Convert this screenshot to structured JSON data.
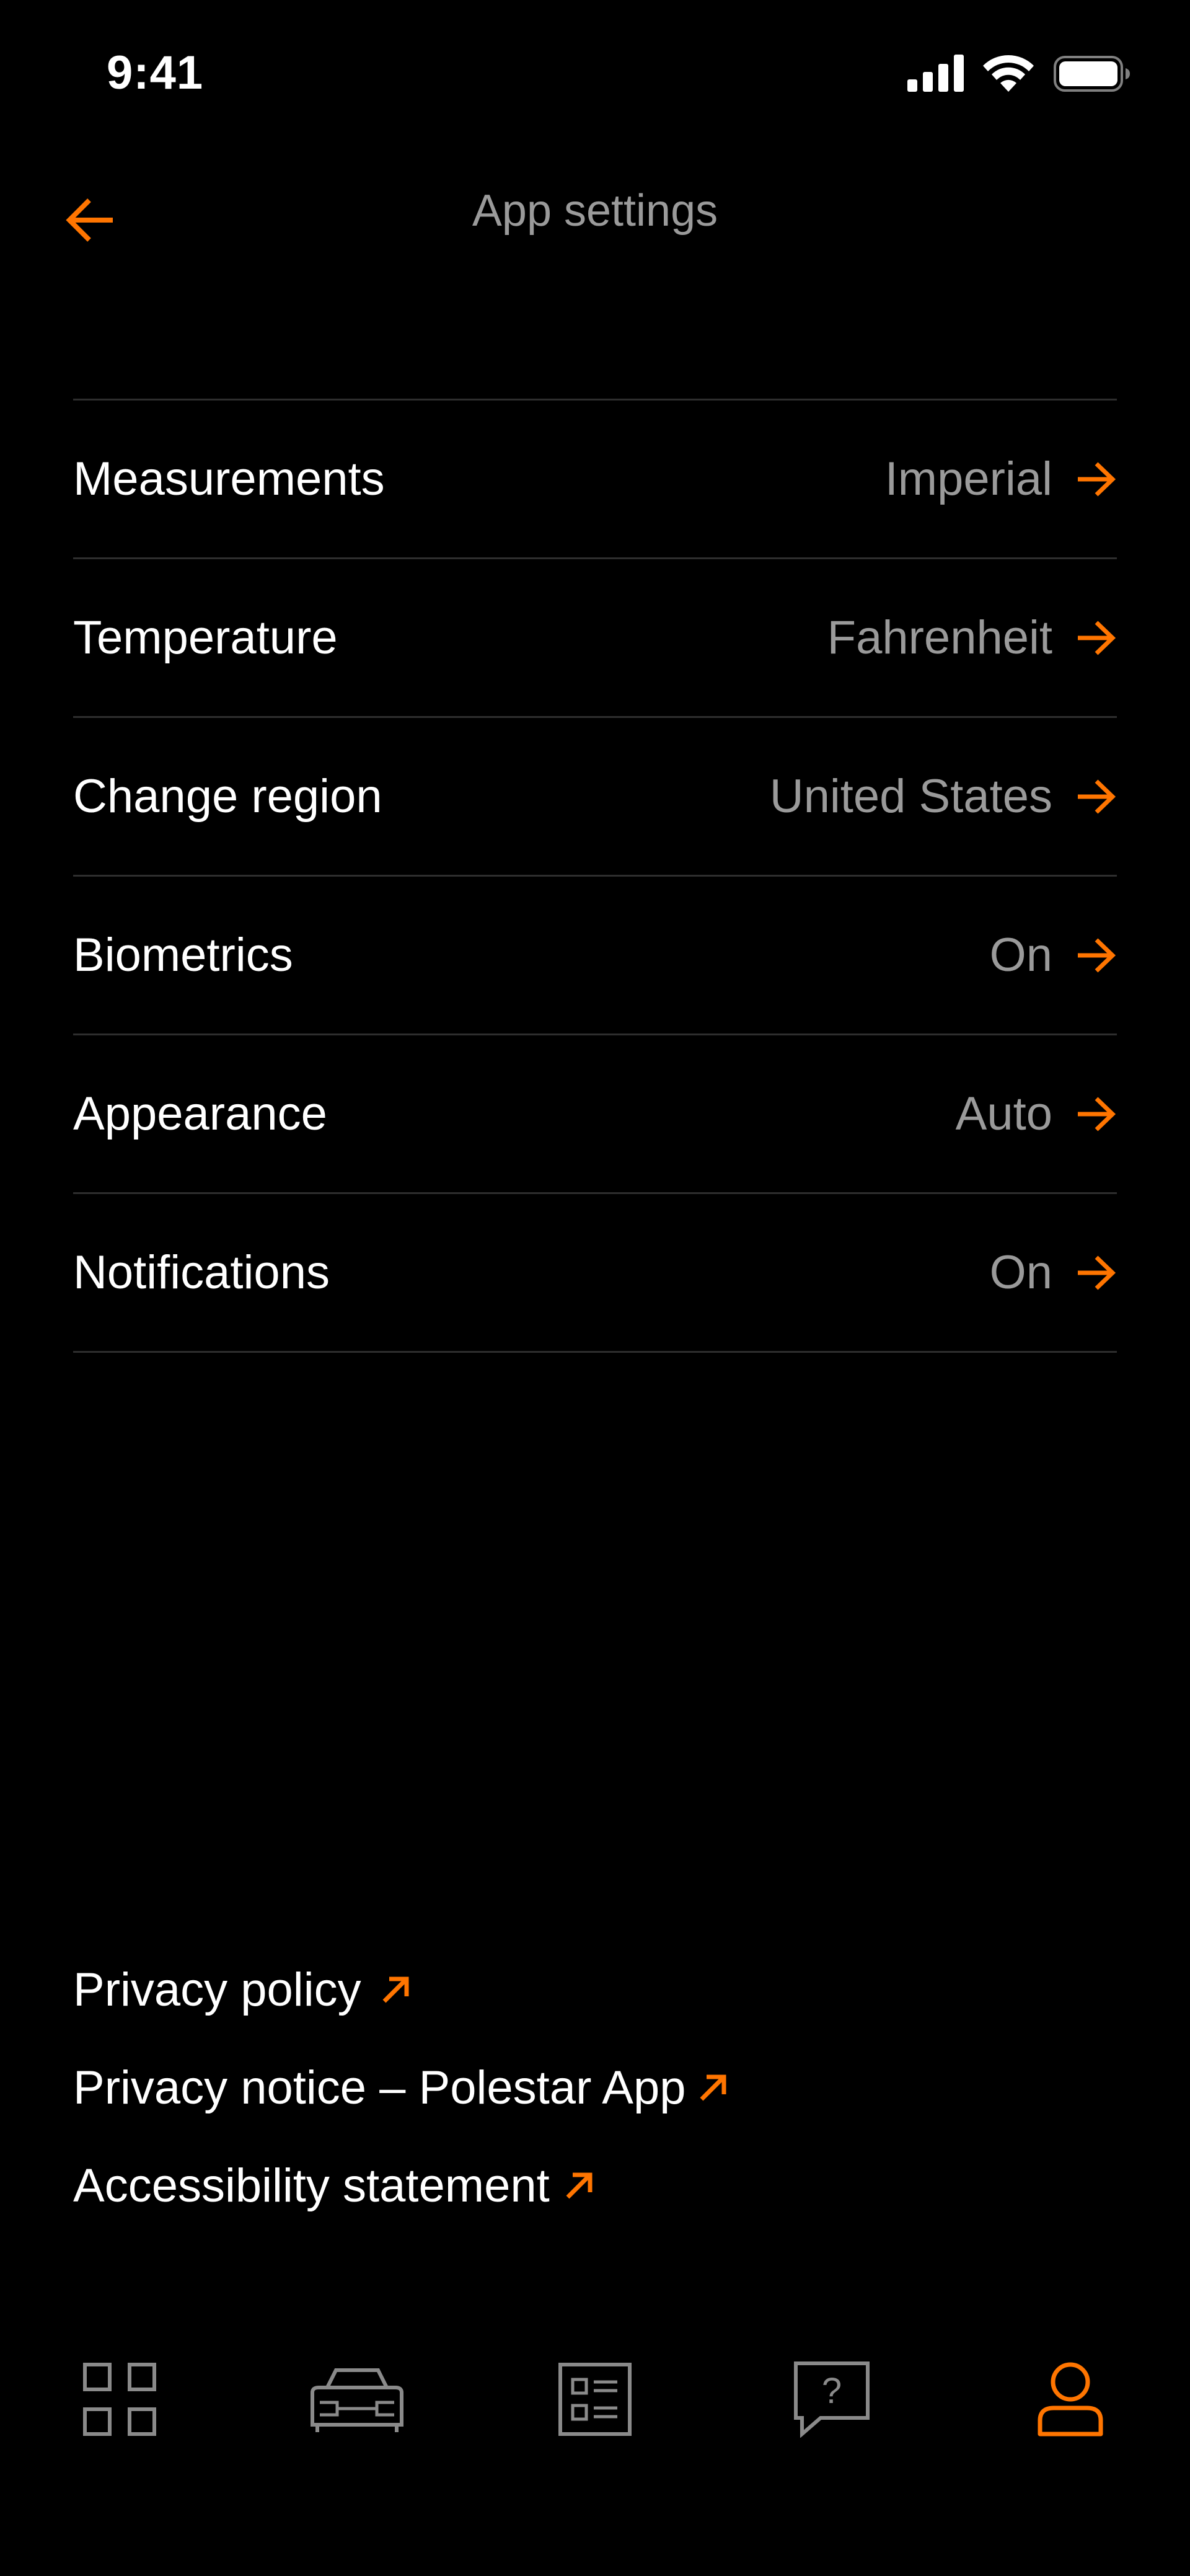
{
  "status_bar": {
    "time": "9:41"
  },
  "header": {
    "title": "App settings"
  },
  "settings": [
    {
      "label": "Measurements",
      "value": "Imperial"
    },
    {
      "label": "Temperature",
      "value": "Fahrenheit"
    },
    {
      "label": "Change region",
      "value": "United States"
    },
    {
      "label": "Biometrics",
      "value": "On"
    },
    {
      "label": "Appearance",
      "value": "Auto"
    },
    {
      "label": "Notifications",
      "value": "On"
    }
  ],
  "links": [
    {
      "label": "Privacy policy"
    },
    {
      "label": "Privacy notice – Polestar App"
    },
    {
      "label": "Accessibility statement"
    }
  ],
  "tabs": [
    {
      "icon": "grid-icon"
    },
    {
      "icon": "car-icon"
    },
    {
      "icon": "list-icon"
    },
    {
      "icon": "help-icon"
    },
    {
      "icon": "profile-icon",
      "active": true
    }
  ],
  "colors": {
    "background": "#000000",
    "accent": "#ff7500",
    "text_primary": "#ffffff",
    "text_secondary": "#9a9a9a",
    "divider": "#2e2e2e"
  }
}
